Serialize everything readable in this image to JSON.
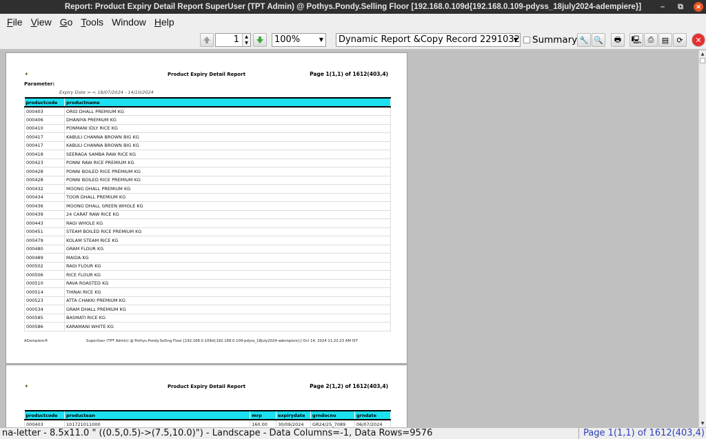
{
  "window": {
    "title": "Report: Product Expiry Detail Report  SuperUser (TPT Admin) @ Pothys.Pondy.Selling Floor [192.168.0.109d{192.168.0.109-pdyss_18july2024-adempiere}]"
  },
  "menu": [
    {
      "key": "F",
      "rest": "ile"
    },
    {
      "key": "V",
      "rest": "iew"
    },
    {
      "key": "G",
      "rest": "o"
    },
    {
      "key": "T",
      "rest": "ools"
    },
    {
      "key": "W",
      "rest": "indow",
      "nounderline": true
    },
    {
      "key": "H",
      "rest": "elp"
    }
  ],
  "toolbar": {
    "page_value": "1",
    "zoom_value": "100%",
    "report_value": "Dynamic Report &Copy Record 2291032",
    "summary_label": "Summary"
  },
  "report": {
    "title": "Product Expiry Detail Report",
    "page1_label": "Page 1(1,1) of 1612(403,4)",
    "page2_label": "Page 2(1,2) of 1612(403,4)",
    "parameter_label": "Parameter:",
    "parameter_line": "Expiry Date   >-<   18/07/2024 - 14/10/2024",
    "table1_headers": [
      "productcode",
      "productname"
    ],
    "table1_rows": [
      [
        "000403",
        "ORID DHALL PREMIUM KG"
      ],
      [
        "000406",
        "DHANIYA PREMIUM KG"
      ],
      [
        "000410",
        "PONMANI IDLY RICE KG"
      ],
      [
        "000417",
        "KABULI CHANNA BROWN BIG KG"
      ],
      [
        "000417",
        "KABULI CHANNA BROWN BIG KG"
      ],
      [
        "000418",
        "SEERAGA SAMBA RAW RICE KG"
      ],
      [
        "000423",
        "PONNI RAW RICE PREMIUM KG"
      ],
      [
        "000428",
        "PONNI BOILED RICE PREMIUM KG"
      ],
      [
        "000428",
        "PONNI BOILED RICE PREMIUM KG"
      ],
      [
        "000432",
        "MOONG DHALL PREMIUM KG"
      ],
      [
        "000434",
        "TOOR DHALL PREMIUM KG"
      ],
      [
        "000436",
        "MOONG DHALL GREEN WHOLE KG"
      ],
      [
        "000439",
        "24 CARAT RAW RICE KG"
      ],
      [
        "000443",
        "RAGI WHOLE KG"
      ],
      [
        "000451",
        "STEAM BOILED RICE PREMIUM KG"
      ],
      [
        "000479",
        "KOLAM STEAM RICE KG"
      ],
      [
        "000480",
        "GRAM FLOUR KG"
      ],
      [
        "000489",
        "MAIDA KG"
      ],
      [
        "000502",
        "RAGI FLOUR KG"
      ],
      [
        "000506",
        "RICE FLOUR KG"
      ],
      [
        "000510",
        "RAVA ROASTED KG"
      ],
      [
        "000514",
        "THINAI RICE KG"
      ],
      [
        "000523",
        "ATTA CHAKKI PREMIUM KG"
      ],
      [
        "000534",
        "GRAM DHALL PREMIUM KG"
      ],
      [
        "000585",
        "BASMATI RICE KG"
      ],
      [
        "000586",
        "KARAMANI WHITE KG"
      ]
    ],
    "footer_left": "ADempiere®",
    "footer_right": "SuperUser (TPT Admin) @ Pothys.Pondy.Selling Floor [192.168.0.109d{192.168.0.109-pdyss_18july2024-adempiere}] Oct 14, 2024 11:22:23 AM IST",
    "table2_headers": [
      "productcode",
      "productean",
      "mrp",
      "expirydate",
      "grndocno",
      "grndate"
    ],
    "table2_rows": [
      [
        "000403",
        "101721011000",
        "160.00",
        "30/09/2024",
        "GR24/25_7089",
        "06/07/2024"
      ]
    ]
  },
  "status": {
    "left": "na-letter - 8.5x11.0 \" ((0.5,0.5)->(7.5,10.0)\") - Landscape - Data Columns=-1, Data Rows=9576",
    "right": "Page 1(1,1) of 1612(403,4)"
  }
}
